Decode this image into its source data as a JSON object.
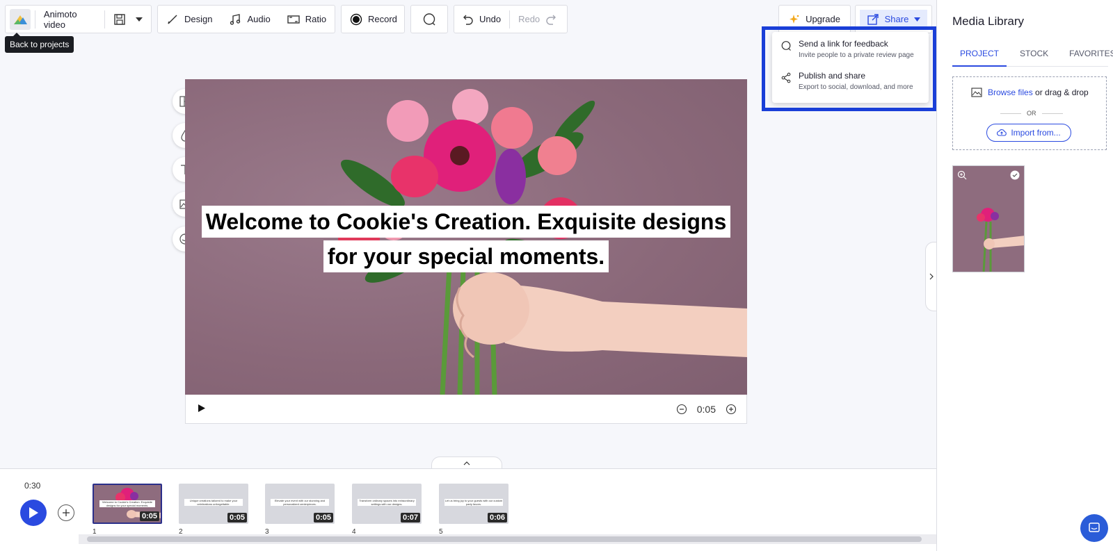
{
  "toolbar": {
    "project_title": "Animoto video",
    "tooltip": "Back to projects",
    "design_label": "Design",
    "audio_label": "Audio",
    "ratio_label": "Ratio",
    "record_label": "Record",
    "undo_label": "Undo",
    "redo_label": "Redo",
    "upgrade_label": "Upgrade",
    "share_label": "Share"
  },
  "share_menu": {
    "items": [
      {
        "title": "Send a link for feedback",
        "subtitle": "Invite people to a private review page"
      },
      {
        "title": "Publish and share",
        "subtitle": "Export to social, download, and more"
      }
    ]
  },
  "canvas": {
    "caption_line1": "Welcome to Cookie's Creation. Exquisite designs",
    "caption_line2": "for your special moments."
  },
  "player": {
    "time": "0:05"
  },
  "timeline": {
    "total": "0:30",
    "scenes": [
      {
        "num": "1",
        "dur": "0:05",
        "text": "Welcome to Cookie's Creation. Exquisite designs for your special moments."
      },
      {
        "num": "2",
        "dur": "0:05",
        "text": "Unique creations tailored to make your celebrations unforgettable."
      },
      {
        "num": "3",
        "dur": "0:05",
        "text": "Elevate your event with our stunning and personalized centerpieces."
      },
      {
        "num": "4",
        "dur": "0:07",
        "text": "Transform ordinary spaces into extraordinary settings with our designs."
      },
      {
        "num": "5",
        "dur": "0:06",
        "text": "Let us bring joy to your guests with our custom party favors."
      }
    ]
  },
  "media_library": {
    "title": "Media Library",
    "tabs": [
      "PROJECT",
      "STOCK",
      "FAVORITES"
    ],
    "browse_link": "Browse files",
    "browse_rest": " or drag & drop",
    "or_label": "OR",
    "import_label": "Import from..."
  },
  "colors": {
    "accent": "#2a4ae0",
    "highlight": "#1a3fd8",
    "canvas_bg": "#8e6c7e"
  }
}
